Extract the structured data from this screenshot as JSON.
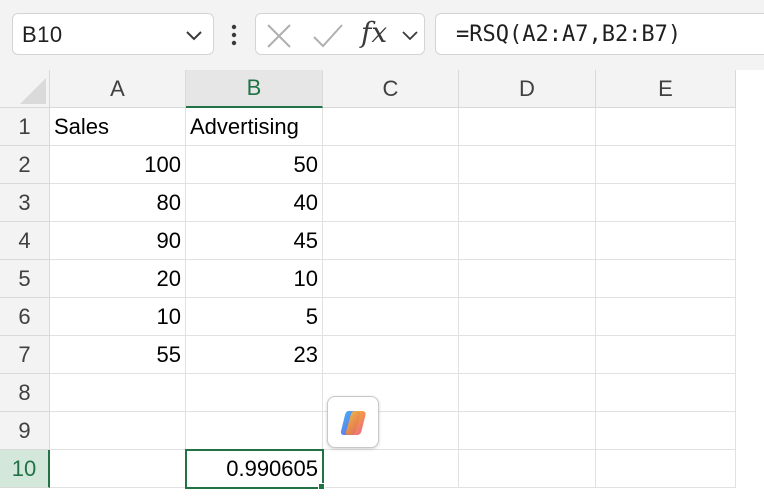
{
  "name_box": {
    "value": "B10"
  },
  "formula_bar": {
    "function_icon": "fx",
    "formula": "=RSQ(A2:A7,B2:B7)"
  },
  "columns": [
    "A",
    "B",
    "C",
    "D",
    "E"
  ],
  "rows": [
    "1",
    "2",
    "3",
    "4",
    "5",
    "6",
    "7",
    "8",
    "9",
    "10"
  ],
  "cells": {
    "A1": "Sales",
    "B1": "Advertising",
    "A2": "100",
    "B2": "50",
    "A3": "80",
    "B3": "40",
    "A4": "90",
    "B4": "45",
    "A5": "20",
    "B5": "10",
    "A6": "10",
    "B6": "5",
    "A7": "55",
    "B7": "23",
    "B10": "0.990605"
  },
  "selection": {
    "active_cell": "B10"
  },
  "colors": {
    "accent": "#217346",
    "header_bg": "#f3f3f3",
    "gridline": "#e1e1e1"
  },
  "icons": {
    "copilot": "copilot-icon",
    "cancel": "cancel-x-icon",
    "enter": "enter-check-icon"
  }
}
